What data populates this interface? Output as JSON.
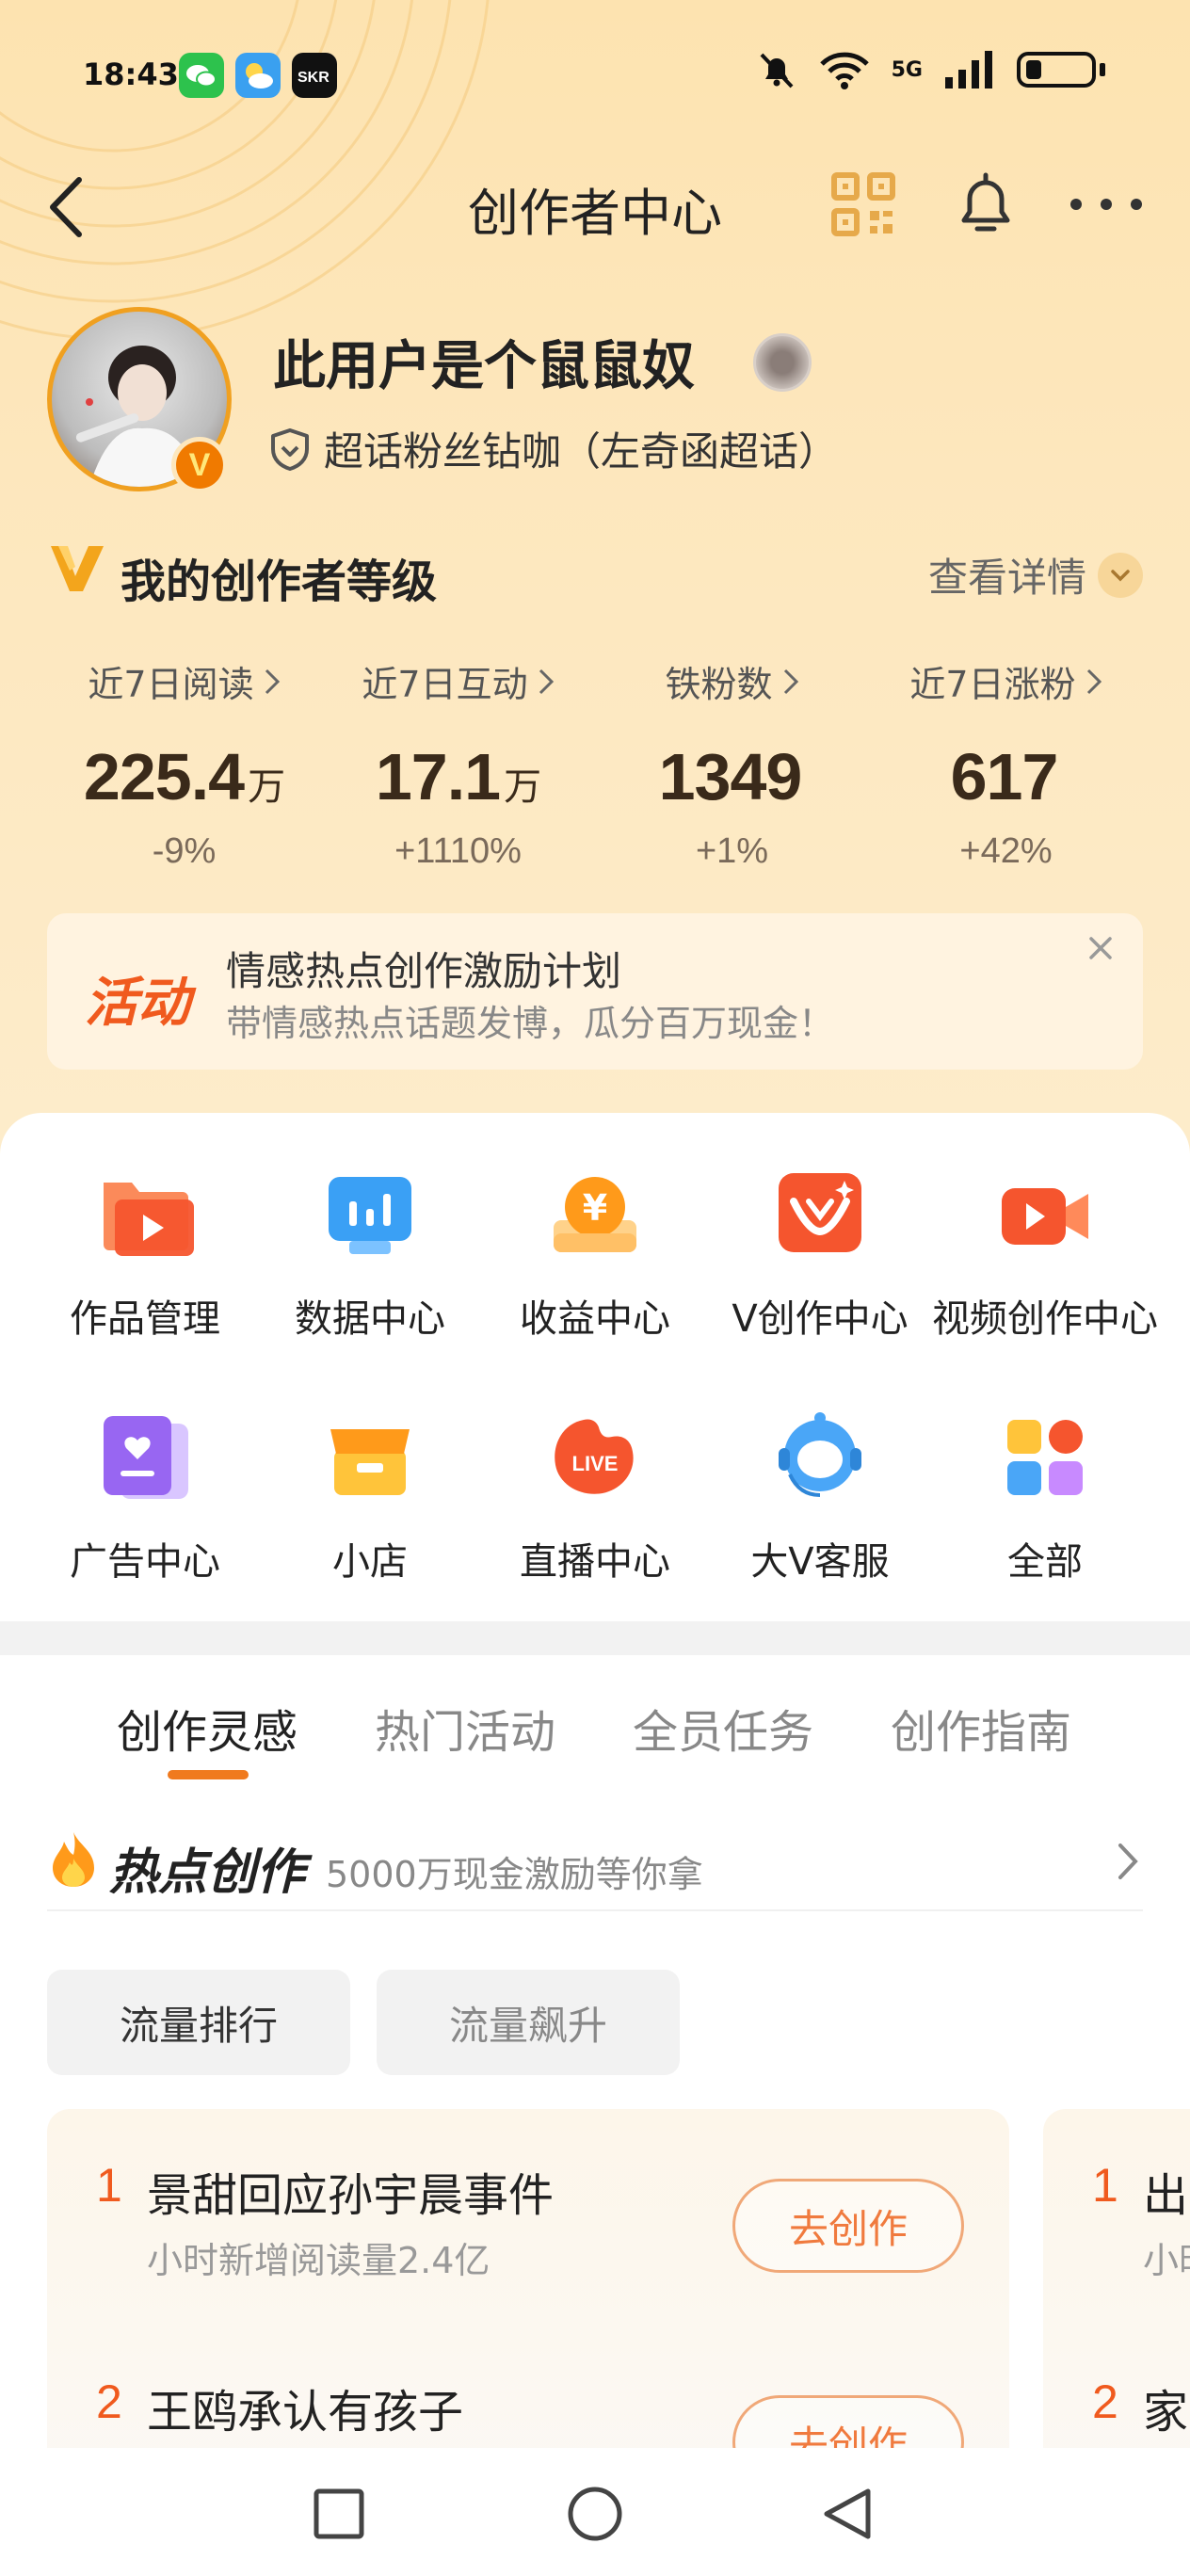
{
  "status_bar": {
    "time": "18:43",
    "network": "5G",
    "apps": [
      "wechat-icon",
      "weather-icon",
      "skr-icon"
    ]
  },
  "nav": {
    "title": "创作者中心"
  },
  "profile": {
    "username": "此用户是个鼠鼠奴",
    "badge": "V",
    "fan_title": "超话粉丝钻咖（左奇函超话）"
  },
  "level": {
    "title": "我的创作者等级",
    "detail_label": "查看详情"
  },
  "stats": [
    {
      "label": "近7日阅读",
      "value": "225.4",
      "unit": "万",
      "change": "-9%"
    },
    {
      "label": "近7日互动",
      "value": "17.1",
      "unit": "万",
      "change": "+1110%"
    },
    {
      "label": "铁粉数",
      "value": "1349",
      "unit": "",
      "change": "+1%"
    },
    {
      "label": "近7日涨粉",
      "value": "617",
      "unit": "",
      "change": "+42%"
    }
  ],
  "banner": {
    "tag": "活动",
    "title": "情感热点创作激励计划",
    "subtitle": "带情感热点话题发博，瓜分百万现金！"
  },
  "tools": [
    {
      "label": "作品管理",
      "icon": "works-folder-icon"
    },
    {
      "label": "数据中心",
      "icon": "data-chart-icon"
    },
    {
      "label": "收益中心",
      "icon": "income-coin-icon"
    },
    {
      "label": "V创作中心",
      "icon": "v-create-icon"
    },
    {
      "label": "视频创作中心",
      "icon": "video-camera-icon"
    },
    {
      "label": "广告中心",
      "icon": "ad-book-icon"
    },
    {
      "label": "小店",
      "icon": "shop-icon"
    },
    {
      "label": "直播中心",
      "icon": "live-icon"
    },
    {
      "label": "大V客服",
      "icon": "customer-service-icon"
    },
    {
      "label": "全部",
      "icon": "all-grid-icon"
    }
  ],
  "tabs": [
    {
      "label": "创作灵感",
      "active": true
    },
    {
      "label": "热门活动",
      "active": false
    },
    {
      "label": "全员任务",
      "active": false
    },
    {
      "label": "创作指南",
      "active": false
    }
  ],
  "hot": {
    "title": "热点创作",
    "subtitle": "5000万现金激励等你拿"
  },
  "filters": [
    {
      "label": "流量排行",
      "active": true
    },
    {
      "label": "流量飙升",
      "active": false
    }
  ],
  "hot_list": [
    {
      "rank": "1",
      "title": "景甜回应孙宇晨事件",
      "sub": "小时新增阅读量2.4亿",
      "button": "去创作"
    },
    {
      "rank": "2",
      "title": "王鸥承认有孩子",
      "sub": "",
      "button": "去创作"
    }
  ],
  "hot_list_2": [
    {
      "rank": "1",
      "title": "出",
      "sub": "小时"
    },
    {
      "rank": "2",
      "title": "家",
      "sub": ""
    }
  ],
  "colors": {
    "accent": "#f07a1e",
    "header_bg": "#fde3b0",
    "rank": "#f05a1e"
  }
}
